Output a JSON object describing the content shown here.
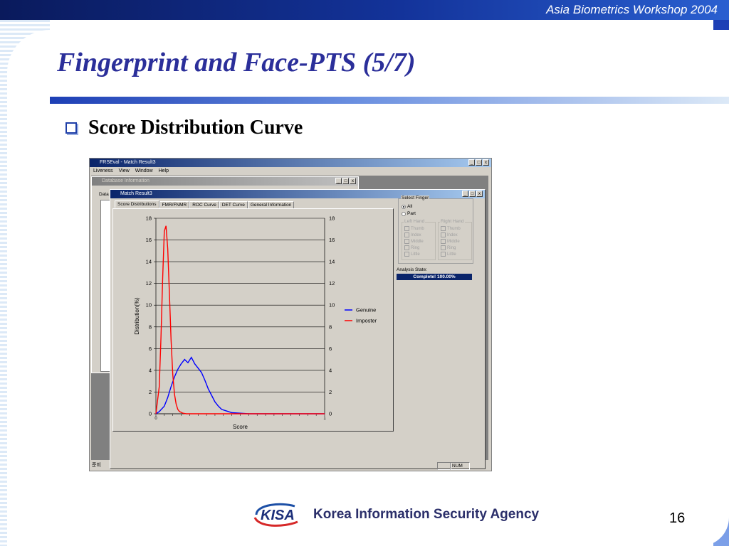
{
  "slide": {
    "workshop": "Asia Biometrics Workshop 2004",
    "title": "Fingerprint and Face-PTS (5/7)",
    "bullet": "Score Distribution Curve",
    "page_number": "16",
    "footer_org": "Korea Information Security Agency",
    "footer_logo": "KISA"
  },
  "app": {
    "main_title": "FRSEval - Match Result3",
    "menu": [
      "Liveness",
      "View",
      "Window",
      "Help"
    ],
    "db_title": "Database Information",
    "db_label": "Data",
    "match_title": "Match Result3",
    "tabs": [
      "Score Distributions",
      "FMR/FNMR",
      "ROC Curve",
      "DET Curve",
      "General Information"
    ],
    "select_finger": {
      "label": "Select Finger",
      "options": [
        "All",
        "Part"
      ],
      "selected": "All",
      "left_hand": {
        "label": "Left Hand",
        "items": [
          "Thumb",
          "Index",
          "Middle",
          "Ring",
          "Little"
        ]
      },
      "right_hand": {
        "label": "Right Hand",
        "items": [
          "Thumb",
          "Index",
          "Middle",
          "Ring",
          "Little"
        ]
      }
    },
    "analysis": {
      "label": "Analysis State:",
      "value": "Complete! 100.00%"
    },
    "status": {
      "left": "준비",
      "num": "NUM"
    },
    "window_buttons": [
      "_",
      "□",
      "x"
    ]
  },
  "chart_data": {
    "type": "line",
    "title": "",
    "xlabel": "Score",
    "ylabel": "Distribution(%)",
    "ylim": [
      0,
      18
    ],
    "yticks": [
      0,
      2,
      4,
      6,
      8,
      10,
      12,
      14,
      16,
      18
    ],
    "xlim": [
      0,
      1
    ],
    "x_tick_start": "0",
    "x_tick_end": "1",
    "legend": "right",
    "grid": true,
    "series": [
      {
        "name": "Genuine",
        "color": "#0000ff",
        "x": [
          0.0,
          0.02,
          0.05,
          0.07,
          0.09,
          0.11,
          0.13,
          0.15,
          0.17,
          0.19,
          0.21,
          0.23,
          0.25,
          0.27,
          0.29,
          0.31,
          0.33,
          0.35,
          0.37,
          0.39,
          0.41,
          0.43,
          0.45,
          0.5,
          0.55,
          0.6,
          0.7,
          0.8,
          0.9,
          1.0
        ],
        "values": [
          0,
          0.2,
          0.7,
          1.5,
          2.5,
          3.4,
          4.1,
          4.6,
          5.0,
          4.7,
          5.2,
          4.6,
          4.2,
          3.8,
          3.1,
          2.3,
          1.7,
          1.1,
          0.7,
          0.4,
          0.3,
          0.2,
          0.1,
          0.05,
          0,
          0,
          0,
          0,
          0,
          0
        ]
      },
      {
        "name": "Imposter",
        "color": "#ff0000",
        "x": [
          0.0,
          0.02,
          0.03,
          0.04,
          0.05,
          0.06,
          0.07,
          0.08,
          0.09,
          0.1,
          0.11,
          0.12,
          0.13,
          0.14,
          0.16,
          0.18,
          0.2,
          0.25,
          0.3,
          0.5,
          0.7,
          1.0
        ],
        "values": [
          0,
          2.5,
          7.0,
          12.5,
          16.8,
          17.3,
          15.2,
          11.0,
          6.8,
          3.6,
          1.8,
          0.9,
          0.4,
          0.2,
          0.05,
          0,
          0,
          0,
          0,
          0,
          0,
          0
        ]
      }
    ]
  }
}
